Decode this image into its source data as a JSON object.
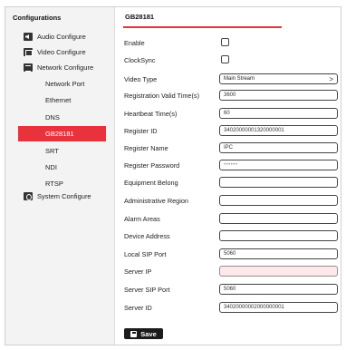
{
  "sidebar": {
    "header": "Configurations",
    "items": [
      {
        "label": "Audio Configure",
        "icon": "speaker-icon"
      },
      {
        "label": "Video Configure",
        "icon": "monitor-icon"
      },
      {
        "label": "Network Configure",
        "icon": "network-icon"
      },
      {
        "label": "System Configure",
        "icon": "gear-icon"
      }
    ],
    "network_sub": [
      "Network Port",
      "Ethernet",
      "DNS",
      "GB28181",
      "SRT",
      "NDI",
      "RTSP"
    ],
    "active_sub": "GB28181"
  },
  "main": {
    "title": "GB28181",
    "labels": {
      "enable": "Enable",
      "clocksync": "ClockSync",
      "video_type": "Video Type",
      "registration_valid_time": "Registration Valid Time(s)",
      "heartbeat_time": "Heartbeat Time(s)",
      "register_id": "Register ID",
      "register_name": "Register Name",
      "register_password": "Register Password",
      "equipment_belong": "Equipment Belong",
      "administrative_region": "Administrative Region",
      "alarm_areas": "Alarm Areas",
      "device_address": "Device Address",
      "local_sip_port": "Local SIP Port",
      "server_ip": "Server IP",
      "server_sip_port": "Server SIP Port",
      "server_id": "Server ID"
    },
    "values": {
      "enable": false,
      "clocksync": false,
      "video_type": "Main Stream",
      "registration_valid_time": "3600",
      "heartbeat_time": "60",
      "register_id": "34020000001320000001",
      "register_name": "IPC",
      "register_password": "••••••",
      "equipment_belong": "",
      "administrative_region": "",
      "alarm_areas": "",
      "device_address": "",
      "local_sip_port": "5060",
      "server_ip": "",
      "server_sip_port": "5060",
      "server_id": "34020000002000000001"
    },
    "save_label": "Save"
  },
  "colors": {
    "accent": "#e8323c",
    "button": "#1c1c1c",
    "error_field": "#fde9ea"
  }
}
